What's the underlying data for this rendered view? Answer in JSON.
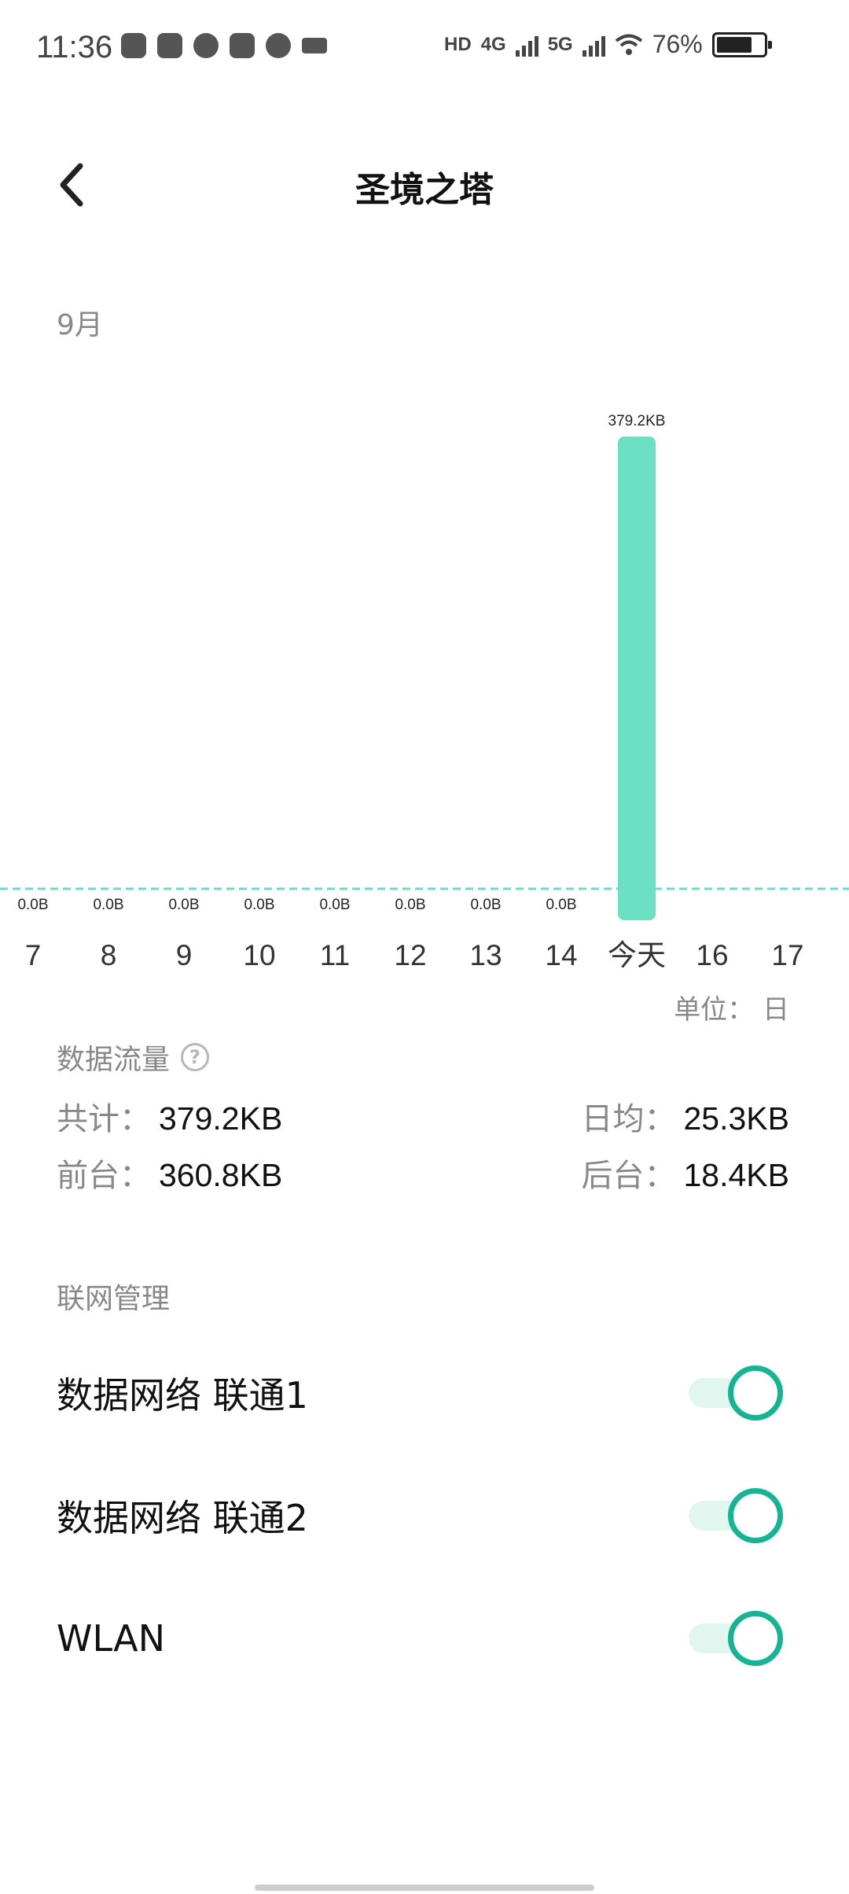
{
  "status_bar": {
    "time": "11:36",
    "hd_badge": "HD",
    "net1_label": "4G",
    "net2_label": "5G",
    "battery_text": "76%",
    "battery_level": 0.76
  },
  "header": {
    "title": "圣境之塔"
  },
  "month_label": "9月",
  "chart_data": {
    "type": "bar",
    "categories": [
      "7",
      "8",
      "9",
      "10",
      "11",
      "12",
      "13",
      "14",
      "今天",
      "16",
      "17"
    ],
    "values": [
      0,
      0,
      0,
      0,
      0,
      0,
      0,
      0,
      379.2,
      null,
      null
    ],
    "value_labels": [
      "0.0B",
      "0.0B",
      "0.0B",
      "0.0B",
      "0.0B",
      "0.0B",
      "0.0B",
      "0.0B",
      "379.2KB",
      "",
      ""
    ],
    "unit": "KB",
    "highlight_category": "今天",
    "color": "#6be0c3",
    "average_line_color": "#6fd7c9"
  },
  "unit_label": "单位：  日",
  "data_usage": {
    "title": "数据流量",
    "total_label": "共计：",
    "total_value": "379.2KB",
    "daily_avg_label": "日均：",
    "daily_avg_value": "25.3KB",
    "foreground_label": "前台：",
    "foreground_value": "360.8KB",
    "background_label": "后台：",
    "background_value": "18.4KB"
  },
  "network": {
    "title": "联网管理",
    "items": [
      {
        "label": "数据网络 联通1",
        "enabled": true
      },
      {
        "label": "数据网络 联通2",
        "enabled": true
      },
      {
        "label": "WLAN",
        "enabled": true
      }
    ]
  },
  "colors": {
    "accent": "#16b493",
    "bar": "#6be0c3",
    "muted_text": "#888888"
  }
}
